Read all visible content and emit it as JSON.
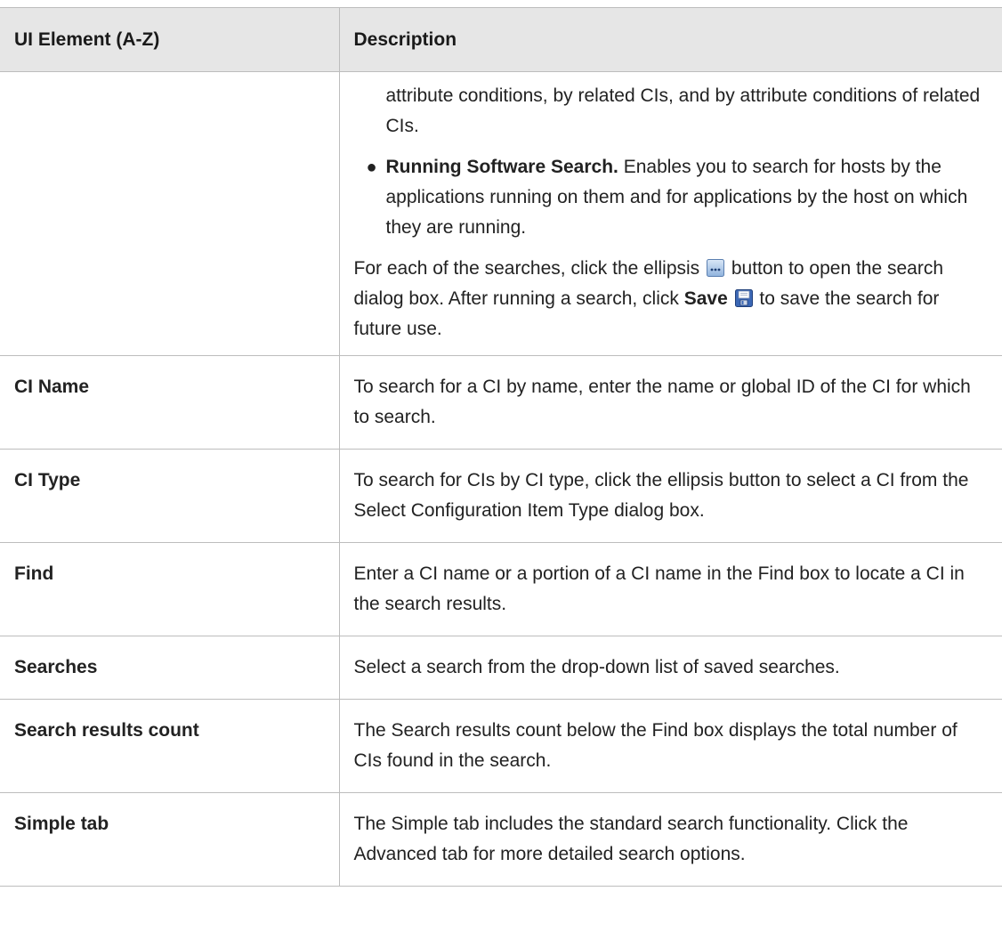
{
  "table": {
    "header": {
      "col1": "UI Element (A-Z)",
      "col2": "Description"
    },
    "continuation": {
      "intro_text": "attribute conditions, by related CIs, and by attribute conditions of related CIs.",
      "bullet": {
        "term": "Running Software Search.",
        "text": " Enables you to search for hosts by the applications running on them and for applications by the host on which they are running."
      },
      "para": {
        "part1": "For each of the searches, click the ellipsis ",
        "ellipsis_icon": "ellipsis-button-icon",
        "part2": " button to open the search dialog box. After running a search, click ",
        "save_label": "Save",
        "save_icon": "save-floppy-icon",
        "part3": " to save the search for future use."
      }
    },
    "rows": [
      {
        "element": "CI Name",
        "description": "To search for a CI by name, enter the name or global ID of the CI for which to search."
      },
      {
        "element": "CI Type",
        "description": "To search for CIs by CI type, click the ellipsis button to select a CI from the Select Configuration Item Type dialog box."
      },
      {
        "element": "Find",
        "description": "Enter a CI name or a portion of a CI name in the Find box to locate a CI in the search results."
      },
      {
        "element": "Searches",
        "description": "Select a search from the drop-down list of saved searches."
      },
      {
        "element": "Search results count",
        "description": "The Search results count below the Find box displays the total number of CIs found in the search."
      },
      {
        "element": "Simple tab",
        "description": "The Simple tab includes the standard search functionality. Click the Advanced tab for more detailed search options."
      }
    ]
  }
}
